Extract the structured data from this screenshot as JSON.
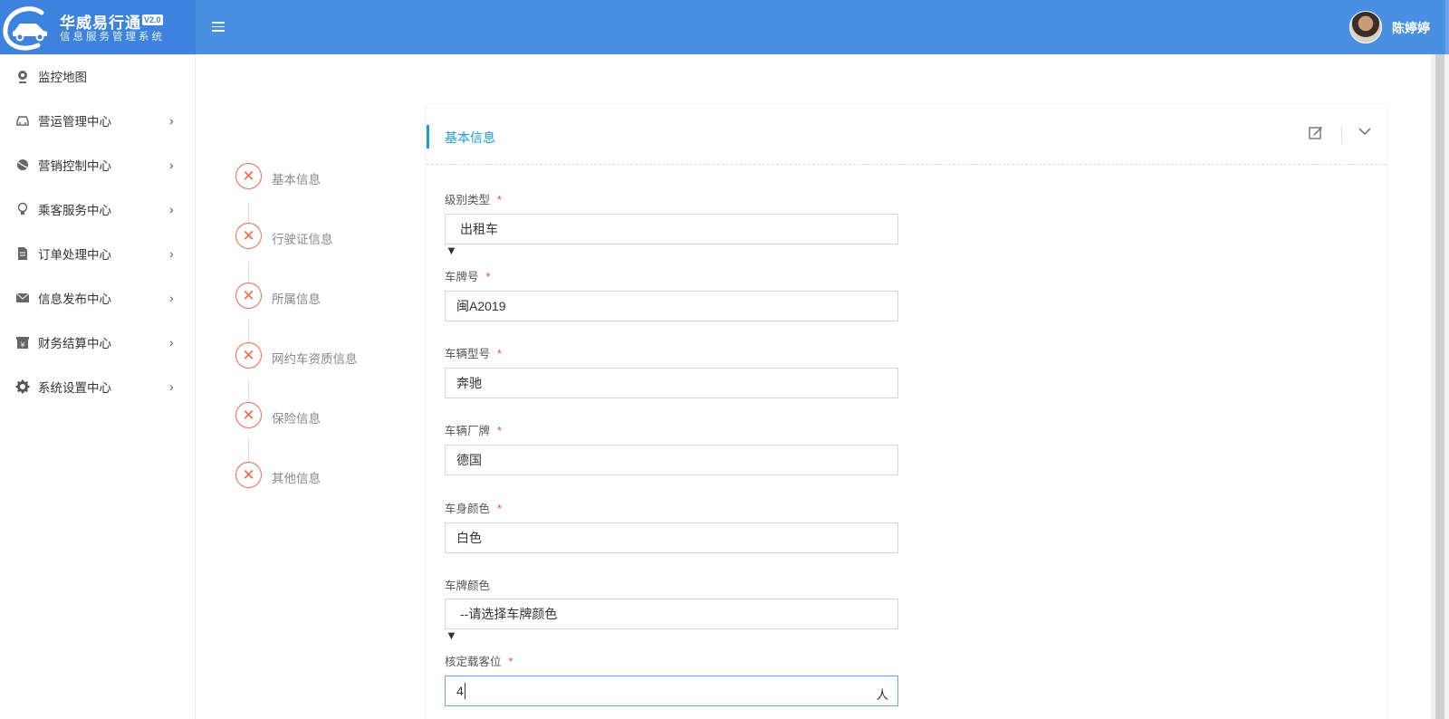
{
  "app": {
    "title": "华威易行通",
    "version": "V2.0",
    "subtitle": "信息服务管理系统",
    "user_name": "陈婷婷"
  },
  "colors": {
    "header": "#4a90e2",
    "accent": "#1e9bd7",
    "error": "#f26a4b",
    "required": "#e64c3c"
  },
  "sidebar": {
    "items": [
      {
        "label": "监控地图",
        "icon": "map-pin-icon",
        "has_arrow": false
      },
      {
        "label": "营运管理中心",
        "icon": "car-icon",
        "has_arrow": true
      },
      {
        "label": "营销控制中心",
        "icon": "ball-icon",
        "has_arrow": true
      },
      {
        "label": "乘客服务中心",
        "icon": "lightbulb-icon",
        "has_arrow": true
      },
      {
        "label": "订单处理中心",
        "icon": "document-icon",
        "has_arrow": true
      },
      {
        "label": "信息发布中心",
        "icon": "envelope-icon",
        "has_arrow": true
      },
      {
        "label": "财务结算中心",
        "icon": "yen-box-icon",
        "has_arrow": true
      },
      {
        "label": "系统设置中心",
        "icon": "gear-icon",
        "has_arrow": true
      }
    ]
  },
  "steps": [
    {
      "label": "基本信息",
      "status": "error"
    },
    {
      "label": "行驶证信息",
      "status": "error"
    },
    {
      "label": "所属信息",
      "status": "error"
    },
    {
      "label": "网约车资质信息",
      "status": "error"
    },
    {
      "label": "保险信息",
      "status": "error"
    },
    {
      "label": "其他信息",
      "status": "error"
    }
  ],
  "card": {
    "title": "基本信息"
  },
  "form": {
    "level_type": {
      "label": "级别类型",
      "required": "*",
      "value": "出租车"
    },
    "plate_number": {
      "label": "车牌号",
      "required": "*",
      "value": "闽A2019"
    },
    "vehicle_model": {
      "label": "车辆型号",
      "required": "*",
      "value": "奔驰"
    },
    "vehicle_brand": {
      "label": "车辆厂牌",
      "required": "*",
      "value": "德国"
    },
    "body_color": {
      "label": "车身颜色",
      "required": "*",
      "value": "白色"
    },
    "plate_color": {
      "label": "车牌颜色",
      "value": "--请选择车牌颜色"
    },
    "seats": {
      "label": "核定载客位",
      "required": "*",
      "value": "4",
      "unit": "人"
    }
  }
}
